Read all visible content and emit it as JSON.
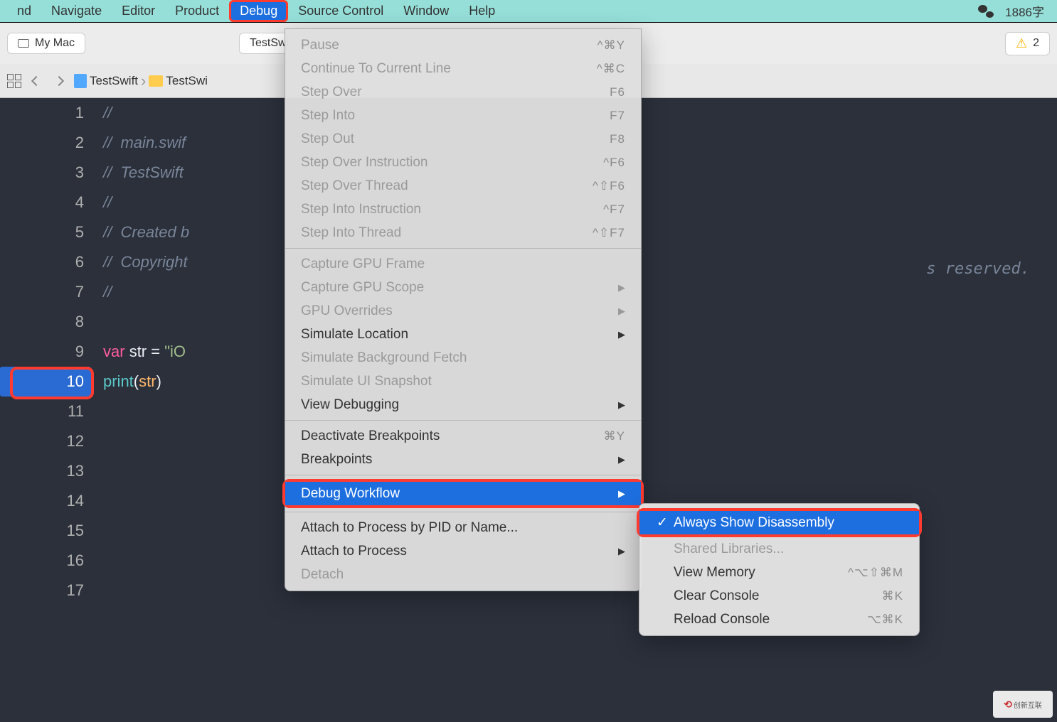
{
  "menubar": {
    "items": [
      "nd",
      "Navigate",
      "Editor",
      "Product",
      "Debug",
      "Source Control",
      "Window",
      "Help"
    ],
    "highlighted_index": 4,
    "right_text": "1886字"
  },
  "toolbar": {
    "device": "My Mac",
    "scheme": "TestSwi",
    "warning_count": "2"
  },
  "breadcrumb": {
    "parts": [
      "TestSwift",
      "TestSwi"
    ]
  },
  "code": {
    "lines": [
      {
        "n": "1",
        "seg": [
          {
            "t": "//",
            "c": "c-comment"
          }
        ]
      },
      {
        "n": "2",
        "seg": [
          {
            "t": "//  main.swif",
            "c": "c-comment"
          }
        ]
      },
      {
        "n": "3",
        "seg": [
          {
            "t": "//  TestSwift",
            "c": "c-comment"
          }
        ]
      },
      {
        "n": "4",
        "seg": [
          {
            "t": "//",
            "c": "c-comment"
          }
        ]
      },
      {
        "n": "5",
        "seg": [
          {
            "t": "//  Created b",
            "c": "c-comment"
          }
        ]
      },
      {
        "n": "6",
        "seg": [
          {
            "t": "//  Copyright",
            "c": "c-comment"
          }
        ]
      },
      {
        "n": "7",
        "seg": [
          {
            "t": "//",
            "c": "c-comment"
          }
        ]
      },
      {
        "n": "8",
        "seg": []
      },
      {
        "n": "9",
        "seg": [
          {
            "t": "var ",
            "c": "c-kw"
          },
          {
            "t": "str",
            "c": "c-id"
          },
          {
            "t": " = ",
            "c": "c-op"
          },
          {
            "t": "\"iO",
            "c": "c-str"
          }
        ]
      },
      {
        "n": "10",
        "seg": [
          {
            "t": "print",
            "c": "c-fn"
          },
          {
            "t": "(",
            "c": "c-op"
          },
          {
            "t": "str",
            "c": "c-var"
          },
          {
            "t": ")",
            "c": "c-op"
          }
        ],
        "bp": true
      },
      {
        "n": "11",
        "seg": []
      },
      {
        "n": "12",
        "seg": []
      },
      {
        "n": "13",
        "seg": []
      },
      {
        "n": "14",
        "seg": []
      },
      {
        "n": "15",
        "seg": []
      },
      {
        "n": "16",
        "seg": []
      },
      {
        "n": "17",
        "seg": []
      }
    ],
    "right_comment": "s reserved."
  },
  "debug_menu": [
    {
      "type": "item",
      "label": "Pause",
      "shortcut": "^⌘Y",
      "disabled": true
    },
    {
      "type": "item",
      "label": "Continue To Current Line",
      "shortcut": "^⌘C",
      "disabled": true
    },
    {
      "type": "item",
      "label": "Step Over",
      "shortcut": "F6",
      "disabled": true
    },
    {
      "type": "item",
      "label": "Step Into",
      "shortcut": "F7",
      "disabled": true
    },
    {
      "type": "item",
      "label": "Step Out",
      "shortcut": "F8",
      "disabled": true
    },
    {
      "type": "item",
      "label": "Step Over Instruction",
      "shortcut": "^F6",
      "disabled": true
    },
    {
      "type": "item",
      "label": "Step Over Thread",
      "shortcut": "^⇧F6",
      "disabled": true
    },
    {
      "type": "item",
      "label": "Step Into Instruction",
      "shortcut": "^F7",
      "disabled": true
    },
    {
      "type": "item",
      "label": "Step Into Thread",
      "shortcut": "^⇧F7",
      "disabled": true
    },
    {
      "type": "sep"
    },
    {
      "type": "item",
      "label": "Capture GPU Frame",
      "disabled": true
    },
    {
      "type": "item",
      "label": "Capture GPU Scope",
      "arrow": true,
      "disabled": true
    },
    {
      "type": "item",
      "label": "GPU Overrides",
      "arrow": true,
      "disabled": true
    },
    {
      "type": "item",
      "label": "Simulate Location",
      "arrow": true
    },
    {
      "type": "item",
      "label": "Simulate Background Fetch",
      "disabled": true
    },
    {
      "type": "item",
      "label": "Simulate UI Snapshot",
      "disabled": true
    },
    {
      "type": "item",
      "label": "View Debugging",
      "arrow": true
    },
    {
      "type": "sep"
    },
    {
      "type": "item",
      "label": "Deactivate Breakpoints",
      "shortcut": "⌘Y"
    },
    {
      "type": "item",
      "label": "Breakpoints",
      "arrow": true
    },
    {
      "type": "sep"
    },
    {
      "type": "item",
      "label": "Debug Workflow",
      "arrow": true,
      "hovered": true,
      "boxed": true
    },
    {
      "type": "sep"
    },
    {
      "type": "item",
      "label": "Attach to Process by PID or Name..."
    },
    {
      "type": "item",
      "label": "Attach to Process",
      "arrow": true
    },
    {
      "type": "item",
      "label": "Detach",
      "disabled": true
    }
  ],
  "submenu": [
    {
      "label": "Always Show Disassembly",
      "checked": true,
      "hovered": true,
      "boxed": true
    },
    {
      "label": "Shared Libraries...",
      "disabled": true
    },
    {
      "label": "View Memory",
      "shortcut": "^⌥⇧⌘M"
    },
    {
      "label": "Clear Console",
      "shortcut": "⌘K"
    },
    {
      "label": "Reload Console",
      "shortcut": "⌥⌘K"
    }
  ],
  "watermark": "创新互联"
}
